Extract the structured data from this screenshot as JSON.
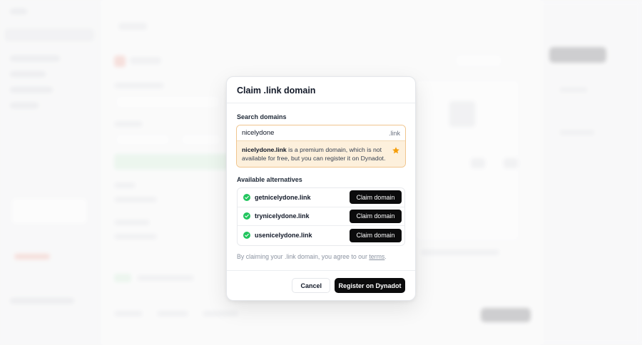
{
  "dialog": {
    "title": "Claim .link domain",
    "search_label": "Search domains",
    "search_value": "nicelydone",
    "search_suffix": ".link",
    "premium_domain": "nicelydone.link",
    "premium_message": " is a premium domain, which is not available for free, but you can register it on Dynadot.",
    "alternatives_label": "Available alternatives",
    "alternatives": [
      {
        "domain": "getnicelydone.link",
        "button": "Claim domain"
      },
      {
        "domain": "trynicelydone.link",
        "button": "Claim domain"
      },
      {
        "domain": "usenicelydone.link",
        "button": "Claim domain"
      }
    ],
    "terms_prefix": "By claiming your .link domain, you agree to our ",
    "terms_link": "terms",
    "terms_suffix": ".",
    "cancel_label": "Cancel",
    "register_label": "Register on Dynadot"
  },
  "icons": {
    "premium": "star-icon",
    "available": "check-circle-icon"
  },
  "colors": {
    "premium_bg": "#fdf0dc",
    "star": "#f59e0b",
    "check": "#22c55e",
    "primary_button": "#0b0b0c"
  }
}
